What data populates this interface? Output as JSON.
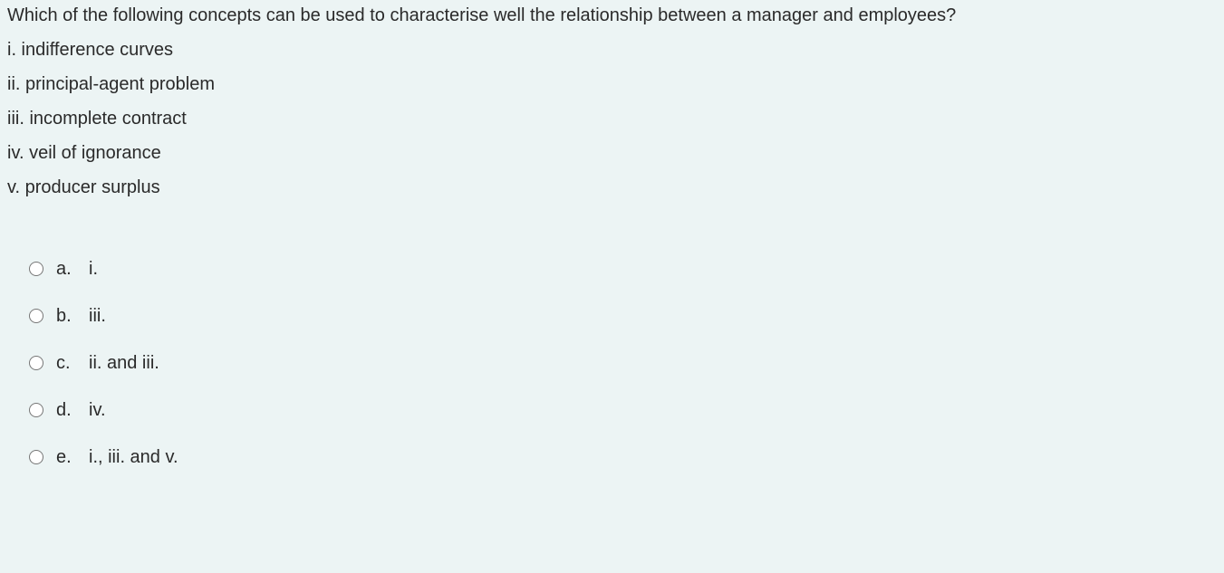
{
  "question": {
    "prompt": "Which of the following concepts can be used to characterise well the relationship between a manager and employees?",
    "concepts": [
      "i. indifference curves",
      "ii. principal-agent problem",
      "iii. incomplete contract",
      "iv. veil of ignorance",
      "v. producer surplus"
    ],
    "options": [
      {
        "letter": "a.",
        "text": "i."
      },
      {
        "letter": "b.",
        "text": "iii."
      },
      {
        "letter": "c.",
        "text": "ii. and iii."
      },
      {
        "letter": "d.",
        "text": "iv."
      },
      {
        "letter": "e.",
        "text": "i., iii. and v."
      }
    ]
  }
}
